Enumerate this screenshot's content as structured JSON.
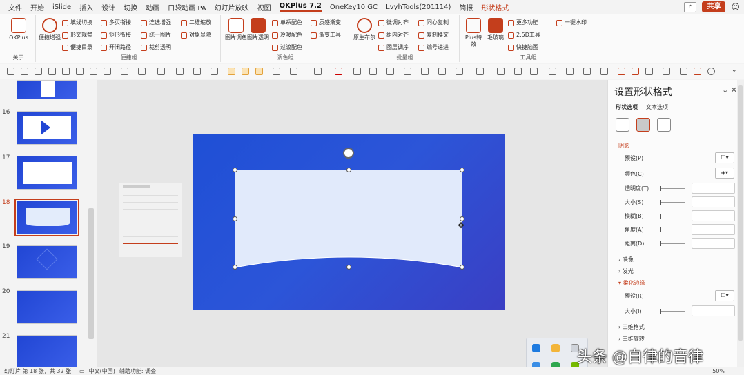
{
  "menu": {
    "tabs": [
      "文件",
      "开始",
      "iSlide",
      "插入",
      "设计",
      "切换",
      "动画",
      "口袋动画 PA",
      "幻灯片放映",
      "视图",
      "OKPlus 7.2",
      "OneKey10 GC",
      "LvyhTools(201114)",
      "简报",
      "形状格式"
    ],
    "share": "共享",
    "comment": "⌂",
    "smile": "☺"
  },
  "ribbon": {
    "about": {
      "label": "关于",
      "okplus": "OKPlus"
    },
    "convenience": {
      "label": "便捷组",
      "big1": "便捷增强",
      "items": [
        "填线切换",
        "形文规整",
        "便捷目录",
        "多页衔接",
        "矩形衔接",
        "开闭路径",
        "连选增强",
        "统一图片",
        "裁剪透明",
        "二维缩放",
        "对象显隐"
      ]
    },
    "color": {
      "label": "调色组",
      "big1": "图片调色",
      "big2": "图片透明",
      "items": [
        "单系配色",
        "冷暖配色",
        "过渡配色",
        "质感渐变",
        "渐变工具"
      ]
    },
    "batch": {
      "label": "批量组",
      "big1": "原生布尔",
      "items": [
        "微调对齐",
        "组内对齐",
        "图层调序",
        "同心复制",
        "复制换文",
        "编号递进"
      ]
    },
    "tools": {
      "label": "工具组",
      "big1": "Plus特效",
      "big2": "毛玻璃",
      "items": [
        "更多功能",
        "2.5D工具",
        "快捷脑图",
        "一键水印"
      ]
    }
  },
  "thumbs": {
    "numbers": [
      "16",
      "17",
      "18",
      "19",
      "20",
      "21"
    ],
    "selected": "18"
  },
  "pane": {
    "title": "设置形状格式",
    "tabs": [
      "形状选项",
      "文本选项"
    ],
    "sections": {
      "shadow": "阴影",
      "reflection": "映像",
      "glow": "发光",
      "soft": "柔化边缘",
      "fmt3d": "三维格式",
      "rot3d": "三维旋转"
    },
    "rows": {
      "preset": "预设(P)",
      "color": "颜色(C)",
      "transp": "透明度(T)",
      "size": "大小(S)",
      "blur": "模糊(B)",
      "angle": "角度(A)",
      "dist": "距离(D)",
      "preset2": "预设(R)",
      "size2": "大小(I)"
    }
  },
  "status": {
    "slide": "幻灯片 第 18 张，共 32 张",
    "lang": "中文(中国)",
    "access": "辅助功能: 调查",
    "zoom": "50%"
  },
  "watermark": "头条 @自律的音律"
}
